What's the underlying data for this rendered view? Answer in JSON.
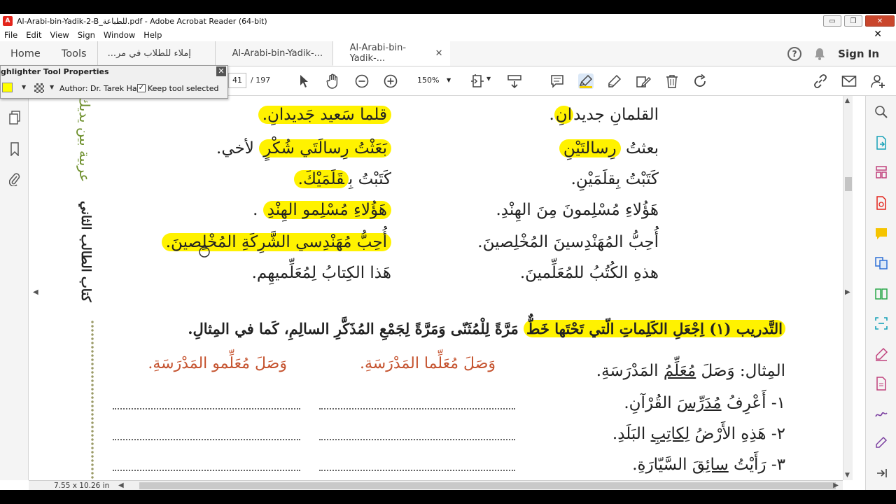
{
  "window": {
    "title": "Al-Arabi-bin-Yadik-2-B_للطباعة.pdf - Adobe Acrobat Reader (64-bit)",
    "min_label": "▭",
    "restore_label": "❐",
    "close_label": "✕"
  },
  "menu": {
    "items": [
      "File",
      "Edit",
      "View",
      "Sign",
      "Window",
      "Help"
    ],
    "close_label": "✕"
  },
  "tabs": {
    "home": "Home",
    "tools": "Tools",
    "docs": [
      {
        "label": "إملاء للطلاب في مر..."
      },
      {
        "label": "Al-Arabi-bin-Yadik-..."
      },
      {
        "label": "Al-Arabi-bin-Yadik-...",
        "close": "✕"
      }
    ],
    "sign_in": "Sign In",
    "help": "?"
  },
  "toolbar": {
    "current_page": "41",
    "total_pages": "/  197",
    "zoom": "150%"
  },
  "highlighter_panel": {
    "title": "ghlighter Tool Properties",
    "close": "✕",
    "author": "Author: Dr. Tarek Ha",
    "keep_label": "Keep tool selected",
    "keep_checked": "✓",
    "color": "#ffff00"
  },
  "document": {
    "spine_green": "عربية بين يديك",
    "spine_black": "كتاب الطالب الثاني",
    "right_column": [
      "القلمانِ جديدانِ.",
      "بعثتُ رسالتَيْنِ",
      "كَتَبْتُ بِقلَمَيْنِ.",
      "هَؤُلاءِ مُسْلِمونَ مِنَ الهِنْدِ.",
      "أُحِبُّ المُهَنْدِسينَ المُخْلِصينَ.",
      "هذهِ الكُتُبُ للمُعَلِّمينَ."
    ],
    "left_column": [
      "قلما سَعيد جَديدانِ.",
      "بَعَثْتُ رِسالَتَي شُكْرٍ لأخي.",
      "كَتَبْتُ بِقَلَمَيْكَ.",
      "هَؤُلاءِ مُسْلِمو الهِنْدِ .",
      "أُحِبُّ مُهَنْدِسي الشَّرِكَةِ المُخْلِصينَ.",
      "هَذا الكِتابُ لِمُعَلِّميهِم."
    ],
    "exercise_title_hl": "التَّدريب (١) اِجْعَلِ الكَلِماتِ الّتي تَحْتَها خَطٌّ",
    "exercise_title_rest": " مَرَّةً لِلْمُثَنّى وَمَرَّةً لِجَمْعِ المُذَكَّرِ السالِمِ، كَما في المِثالِ.",
    "answer_dual": "وَصَلَ مُعَلِّما المَدْرَسَةِ.",
    "answer_plural": "وَصَلَ مُعَلِّمو المَدْرَسَةِ.",
    "example_label": "المِثال: وَصَلَ ",
    "example_word": "مُعَلِّمُ",
    "example_rest": " المَدْرَسَةِ.",
    "items": [
      {
        "num": "١- ",
        "pre": "أَعْرِفُ ",
        "word": "مُدَرِّسَ",
        "post": " القُرْآنِ."
      },
      {
        "num": "٢- ",
        "pre": "هَذِهِ الأَرْضُ ",
        "word": "لِكاتِبِ",
        "post": " البَلَدِ."
      },
      {
        "num": "٣- ",
        "pre": "رَأَيْتُ ",
        "word": "سائِقَ",
        "post": " السَّيّارَةِ."
      }
    ]
  },
  "status": {
    "page_size": "7.55 x 10.26 in"
  },
  "colors": {
    "highlight": "#fff200",
    "answer_text": "#c5532f",
    "spine_green": "#6d8f2b"
  }
}
